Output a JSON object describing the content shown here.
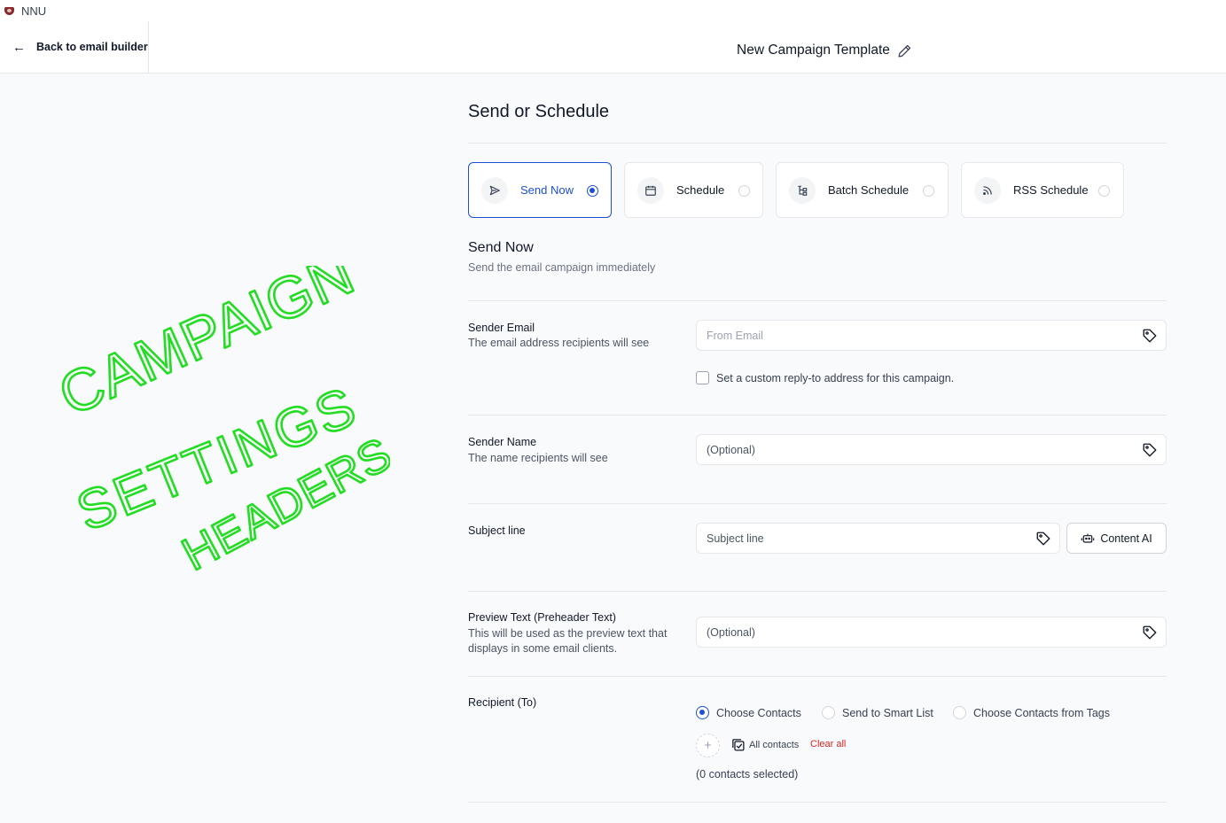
{
  "window": {
    "org_name": "NNU"
  },
  "header": {
    "back_label": "Back to email builder",
    "title": "New Campaign Template"
  },
  "page": {
    "heading": "Send or Schedule"
  },
  "send_options": [
    {
      "label": "Send Now",
      "icon": "send-icon",
      "selected": true
    },
    {
      "label": "Schedule",
      "icon": "calendar-icon",
      "selected": false
    },
    {
      "label": "Batch Schedule",
      "icon": "batch-icon",
      "selected": false
    },
    {
      "label": "RSS Schedule",
      "icon": "rss-icon",
      "selected": false
    }
  ],
  "section": {
    "title": "Send Now",
    "subtitle": "Send the email campaign immediately"
  },
  "sender_email": {
    "label": "Sender Email",
    "description": "The email address recipients will see",
    "placeholder": "From Email",
    "reply_to_label": "Set a custom reply-to address for this campaign."
  },
  "sender_name": {
    "label": "Sender Name",
    "description": "The name recipients will see",
    "placeholder": "(Optional)"
  },
  "subject": {
    "label": "Subject line",
    "placeholder": "Subject line",
    "ai_button": "Content AI"
  },
  "preview_text": {
    "label": "Preview Text (Preheader Text)",
    "description": "This will be used as the preview text that displays in some email clients.",
    "placeholder": "(Optional)"
  },
  "recipient": {
    "label": "Recipient (To)",
    "options": [
      {
        "label": "Choose Contacts",
        "selected": true
      },
      {
        "label": "Send to Smart List",
        "selected": false
      },
      {
        "label": "Choose Contacts from Tags",
        "selected": false
      }
    ],
    "chip_label": "All contacts",
    "clear_label": "Clear all",
    "count_text": "(0 contacts selected)"
  },
  "annotation": {
    "lines": [
      "CAMPAIGN",
      "SETTINGS",
      "HEADERS"
    ],
    "color": "#22dd22"
  },
  "colors": {
    "accent": "#1d4ed8",
    "danger": "#dc2626"
  }
}
